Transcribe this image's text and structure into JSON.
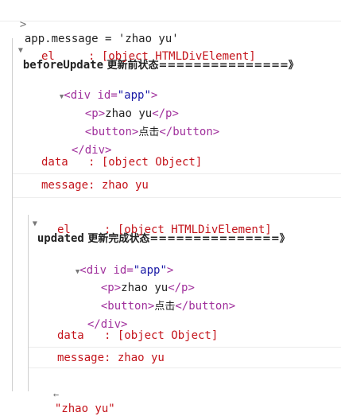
{
  "console": {
    "input_prompt": ">",
    "input_command": "app.message = 'zhao yu'",
    "groups": [
      {
        "label_keyword": "beforeUpdate",
        "label_text": " 更新前状态===============》",
        "el_line": "el     : [object HTMLDivElement]",
        "data_line": "data   : [object Object]",
        "message_line": "message: zhao yu"
      },
      {
        "label_keyword": "updated",
        "label_text": " 更新完成状态===============》",
        "el_line": "el     : [object HTMLDivElement]",
        "data_line": "data   : [object Object]",
        "message_line": "message: zhao yu"
      }
    ],
    "dom": {
      "open_tag": "div",
      "attr_name": "id",
      "attr_value": "\"app\"",
      "p_tag": "p",
      "p_text": "zhao yu",
      "button_tag": "button",
      "button_text": "点击"
    },
    "return_glyph": "←",
    "return_value": "\"zhao yu\""
  },
  "colors": {
    "error_red": "#c4141b",
    "tag_purple": "#a0309c",
    "attr_value_blue": "#1a1aa6"
  }
}
